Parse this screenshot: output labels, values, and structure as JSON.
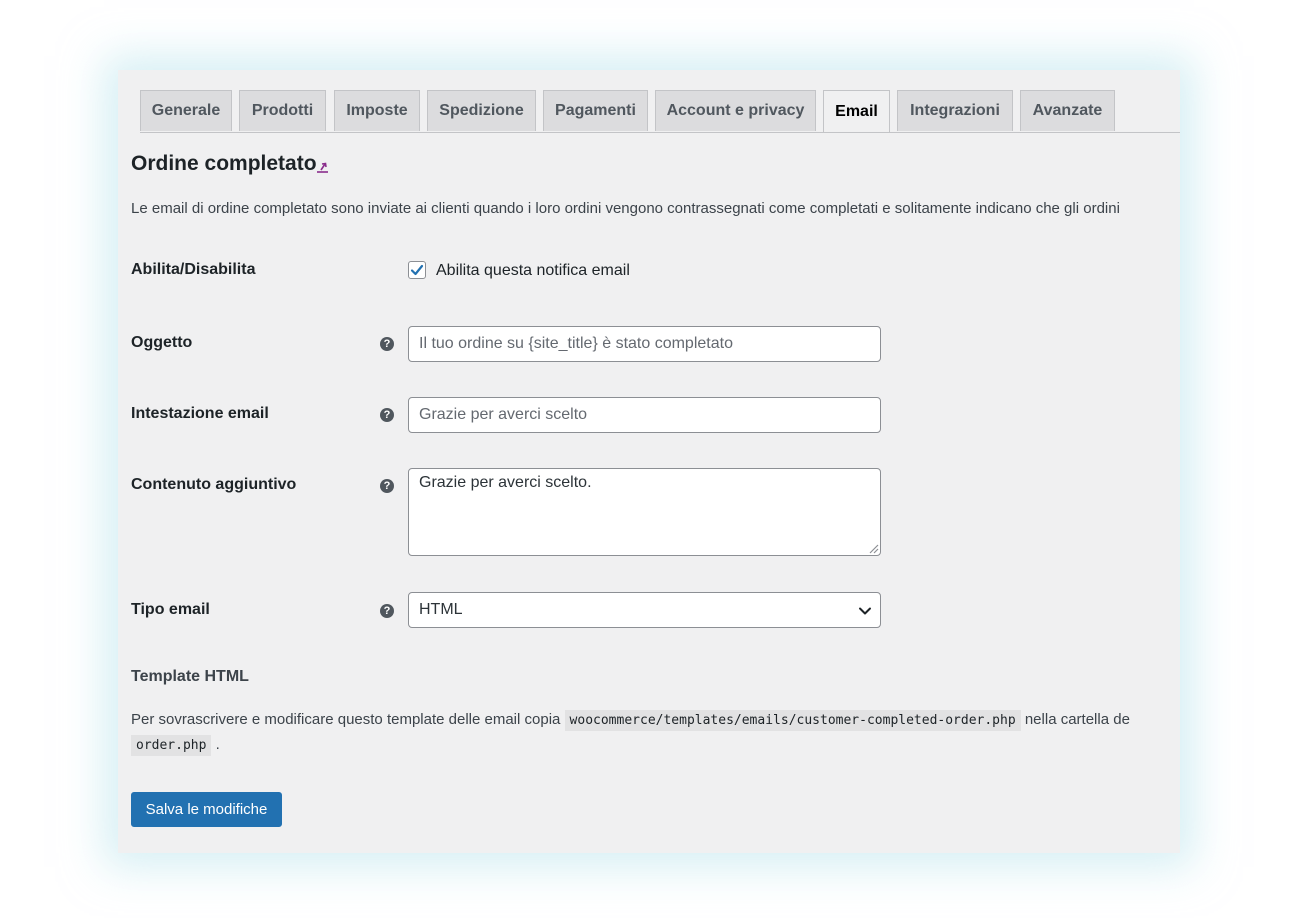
{
  "tabs": [
    {
      "label": "Generale"
    },
    {
      "label": "Prodotti"
    },
    {
      "label": "Imposte"
    },
    {
      "label": "Spedizione"
    },
    {
      "label": "Pagamenti"
    },
    {
      "label": "Account e privacy"
    },
    {
      "label": "Email",
      "active": true
    },
    {
      "label": "Integrazioni"
    },
    {
      "label": "Avanzate"
    }
  ],
  "page": {
    "title": "Ordine completato",
    "description": "Le email di ordine completato sono inviate ai clienti quando i loro ordini vengono contrassegnati come completati e solitamente indicano che gli ordini"
  },
  "form": {
    "enable": {
      "label": "Abilita/Disabilita",
      "checkbox_label": "Abilita questa notifica email",
      "checked": true
    },
    "subject": {
      "label": "Oggetto",
      "placeholder": "Il tuo ordine su {site_title} è stato completato",
      "value": ""
    },
    "heading": {
      "label": "Intestazione email",
      "placeholder": "Grazie per averci scelto",
      "value": ""
    },
    "additional": {
      "label": "Contenuto aggiuntivo",
      "value": "Grazie per averci scelto."
    },
    "email_type": {
      "label": "Tipo email",
      "value": "HTML"
    }
  },
  "template": {
    "title": "Template HTML",
    "text_before": "Per sovrascrivere e modificare questo template delle email copia",
    "code1": "woocommerce/templates/emails/customer-completed-order.php",
    "text_after": "nella cartella de",
    "code2": "order.php",
    "end": "."
  },
  "save_label": "Salva le modifiche",
  "colors": {
    "primary": "#2271b1",
    "panel_bg": "#f0f0f1"
  }
}
